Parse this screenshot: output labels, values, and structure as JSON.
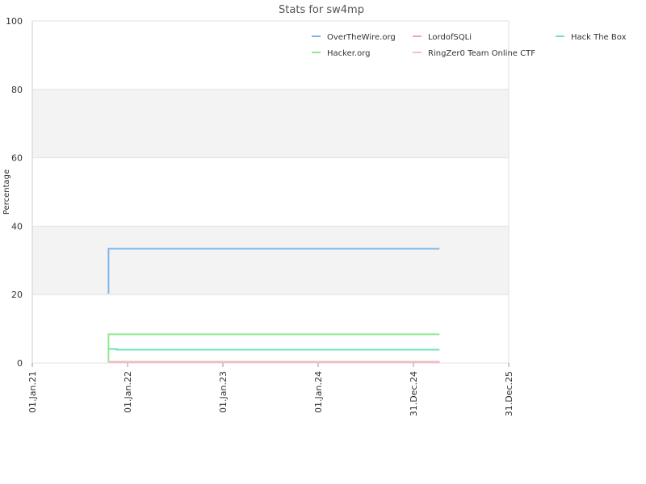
{
  "chart_data": {
    "type": "line",
    "title": "Stats for sw4mp",
    "ylabel": "Percentage",
    "xlabel": "",
    "ylim": [
      0,
      100
    ],
    "yticks": [
      "0",
      "20",
      "40",
      "60",
      "80",
      "100"
    ],
    "xlim": [
      "2021-01-01",
      "2025-12-31"
    ],
    "xticks": [
      {
        "date": "2021-01-01",
        "label": "01.Jan.21"
      },
      {
        "date": "2022-01-01",
        "label": "01.Jan.22"
      },
      {
        "date": "2023-01-01",
        "label": "01.Jan.23"
      },
      {
        "date": "2024-01-01",
        "label": "01.Jan.24"
      },
      {
        "date": "2024-12-31",
        "label": "31.Dec.24"
      },
      {
        "date": "2025-12-31",
        "label": "31.Dec.25"
      }
    ],
    "grid": "alternating horizontal bands",
    "legend_position": "top-right",
    "series": [
      {
        "name": "OverTheWire.org",
        "color": "#7cb5ec",
        "points": [
          {
            "x": "2021-10-20",
            "y": 20.3
          },
          {
            "x": "2021-10-20",
            "y": 33.4
          },
          {
            "x": "2025-04-10",
            "y": 33.4
          }
        ]
      },
      {
        "name": "LordofSQLi",
        "color": "#f0a0c0",
        "points": [
          {
            "x": "2021-10-20",
            "y": 0.3
          },
          {
            "x": "2025-04-10",
            "y": 0.3
          }
        ]
      },
      {
        "name": "Hack The Box",
        "color": "#70e0c0",
        "points": [
          {
            "x": "2021-10-20",
            "y": 4.1
          },
          {
            "x": "2021-11-20",
            "y": 4.1
          },
          {
            "x": "2021-11-20",
            "y": 3.9
          },
          {
            "x": "2025-04-10",
            "y": 3.9
          }
        ]
      },
      {
        "name": "Hacker.org",
        "color": "#90e890",
        "points": [
          {
            "x": "2021-10-20",
            "y": 0.3
          },
          {
            "x": "2021-10-20",
            "y": 8.4
          },
          {
            "x": "2025-04-10",
            "y": 8.4
          }
        ]
      },
      {
        "name": "RingZer0 Team Online CTF",
        "color": "#f5c0c0",
        "points": [
          {
            "x": "2021-10-20",
            "y": 0.4
          },
          {
            "x": "2025-04-10",
            "y": 0.4
          }
        ]
      }
    ]
  }
}
